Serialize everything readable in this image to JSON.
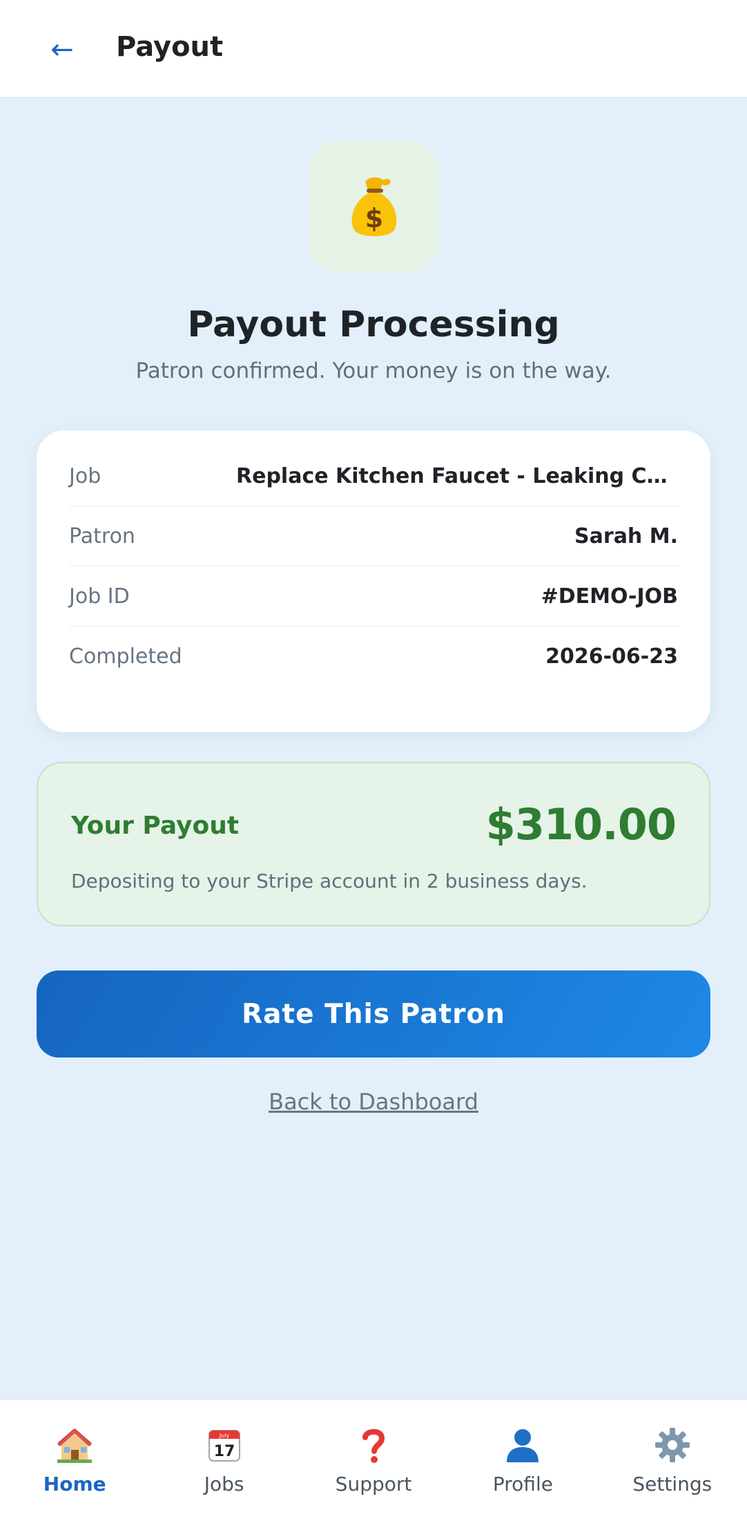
{
  "header": {
    "back_icon": "←",
    "title": "Payout"
  },
  "hero": {
    "icon": "money-bag-icon",
    "title": "Payout Processing",
    "subtitle": "Patron confirmed. Your money is on the way."
  },
  "details": [
    {
      "label": "Job",
      "value": "Replace Kitchen Faucet - Leaking Cons..."
    },
    {
      "label": "Patron",
      "value": "Sarah M."
    },
    {
      "label": "Job ID",
      "value": "#DEMO-JOB"
    },
    {
      "label": "Completed",
      "value": "2026-06-23"
    }
  ],
  "payout": {
    "label": "Your Payout",
    "amount": "$310.00",
    "note": "Depositing to your Stripe account in 2 business days."
  },
  "actions": {
    "primary": "Rate This Patron",
    "secondary": "Back to Dashboard"
  },
  "nav": [
    {
      "label": "Home",
      "icon": "home-icon",
      "active": true
    },
    {
      "label": "Jobs",
      "icon": "calendar-icon",
      "active": false
    },
    {
      "label": "Support",
      "icon": "question-icon",
      "active": false
    },
    {
      "label": "Profile",
      "icon": "profile-icon",
      "active": false
    },
    {
      "label": "Settings",
      "icon": "gear-icon",
      "active": false
    }
  ],
  "calendar_icon": {
    "month": "July",
    "day": "17"
  },
  "colors": {
    "accent": "#1a66c2",
    "success": "#2e7d32",
    "background": "#e3f0fb"
  }
}
